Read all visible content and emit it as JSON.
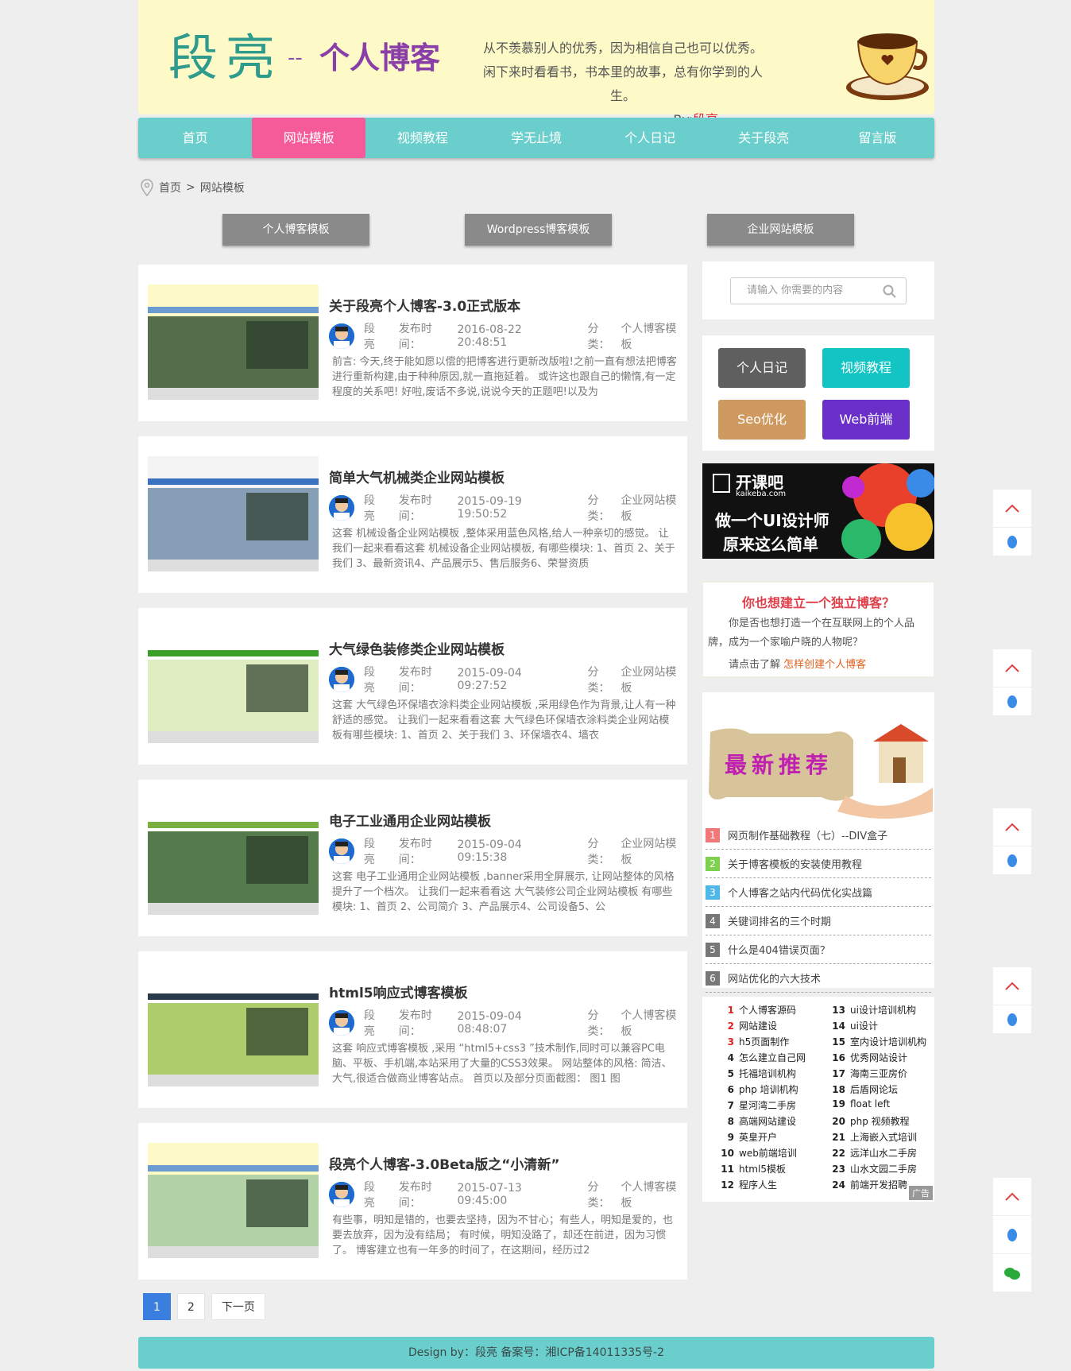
{
  "header": {
    "logo_main": "段亮",
    "logo_dash": "--",
    "logo_sub": "个人博客",
    "motto_line1": "从不羡慕别人的优秀，因为相信自己也可以优秀。",
    "motto_line2": "闲下来时看看书，书本里的故事，总有你学到的人生。",
    "by_prefix": "---By:",
    "by_name": "段亮"
  },
  "nav": {
    "items": [
      "首页",
      "网站模板",
      "视频教程",
      "学无止境",
      "个人日记",
      "关于段亮",
      "留言版"
    ],
    "active": "网站模板"
  },
  "breadcrumb": {
    "home": "首页",
    "sep": ">",
    "current": "网站模板"
  },
  "template_buttons": [
    "个人博客模板",
    "Wordpress博客模板",
    "企业网站模板"
  ],
  "articles": [
    {
      "title": "关于段亮个人博客-3.0正式版本",
      "author": "段亮",
      "time_label": "发布时间：",
      "time": "2016-08-22 20:48:51",
      "cat_label": "分类：",
      "category": "个人博客模板",
      "excerpt": "前言: 今天,终于能如愿以偿的把博客进行更新改版啦!之前一直有想法把博客进行重新构建,由于种种原因,就一直拖延着。 或许这也跟自己的懒惰,有一定程度的关系吧! 好啦,废话不多说,说说今天的正题吧!以及为"
    },
    {
      "title": "简单大气机械类企业网站模板",
      "author": "段亮",
      "time_label": "发布时间：",
      "time": "2015-09-19 19:50:52",
      "cat_label": "分类：",
      "category": "企业网站模板",
      "excerpt": "这套 机械设备企业网站模板 ,整体采用蓝色风格,给人一种亲切的感觉。 让我们一起来看看这套 机械设备企业网站模板, 有哪些模块: 1、首页 2、关于我们 3、最新资讯4、产品展示5、售后服务6、荣誉资质"
    },
    {
      "title": "大气绿色装修类企业网站模板",
      "author": "段亮",
      "time_label": "发布时间：",
      "time": "2015-09-04 09:27:52",
      "cat_label": "分类：",
      "category": "企业网站模板",
      "excerpt": "这套 大气绿色环保墙衣涂料类企业网站模板 ,采用绿色作为背景,让人有一种舒适的感觉。 让我们一起来看看这套 大气绿色环保墙衣涂料类企业网站模板有哪些模块: 1、首页 2、关于我们 3、环保墙衣4、墙衣"
    },
    {
      "title": "电子工业通用企业网站模板",
      "author": "段亮",
      "time_label": "发布时间：",
      "time": "2015-09-04 09:15:38",
      "cat_label": "分类：",
      "category": "企业网站模板",
      "excerpt": "这套 电子工业通用企业网站模板 ,banner采用全屏展示, 让网站整体的风格提升了一个档次。 让我们一起来看看这 大气装修公司企业网站模板 有哪些模块: 1、首页 2、公司简介 3、产品展示4、公司设备5、公"
    },
    {
      "title": "html5响应式博客模板",
      "author": "段亮",
      "time_label": "发布时间：",
      "time": "2015-09-04 08:48:07",
      "cat_label": "分类：",
      "category": "个人博客模板",
      "excerpt": "这套 响应式博客模板 ,采用 “html5+css3 ”技术制作,同时可以兼容PC电脑、平板、手机端,本站采用了大量的CSS3效果。 网站整体的风格: 简洁、大气,很适合做商业博客站点。 首页以及部分页面截图： 图1 图"
    },
    {
      "title": "段亮个人博客-3.0Beta版之“小清新”",
      "author": "段亮",
      "time_label": "发布时间：",
      "time": "2015-07-13 09:45:00",
      "cat_label": "分类：",
      "category": "个人博客模板",
      "excerpt": "有些事，明知是错的，也要去坚持，因为不甘心；有些人，明知是爱的，也要去放弃，因为没有结局； 有时候，明知没路了，却还在前进，因为习惯了。 博客建立也有一年多的时间了，在这期间，经历过2"
    }
  ],
  "pagination": {
    "pages": [
      "1",
      "2"
    ],
    "current": "1",
    "next": "下一页"
  },
  "sidebar": {
    "search_placeholder": "请输入 你需要的内容",
    "tags": [
      {
        "label": "个人日记",
        "color": "#5f5f5f"
      },
      {
        "label": "视频教程",
        "color": "#12c4c4"
      },
      {
        "label": "Seo优化",
        "color": "#cf9a60"
      },
      {
        "label": "Web前端",
        "color": "#6a2fc8"
      }
    ],
    "ad_brand": "开课吧",
    "ad_domain": "kaikeba.com",
    "ad_line1": "做一个UI设计师",
    "ad_line2": "原来这么简单",
    "cta_title": "你也想建立一个独立博客？",
    "cta_text": "你是否也想打造一个在互联网上的个人品牌，成为一个家喻户晓的人物呢？",
    "cta_prompt": "请点击了解",
    "cta_link": "怎样创建个人博客",
    "recent_banner": "最新推荐",
    "recent": [
      {
        "n": "1",
        "text": "网页制作基础教程（七）--DIV盒子",
        "color": "#f07878"
      },
      {
        "n": "2",
        "text": "关于博客模板的安装使用教程",
        "color": "#7ed04f"
      },
      {
        "n": "3",
        "text": "个人博客之站内代码优化实战篇",
        "color": "#4fb8e8"
      },
      {
        "n": "4",
        "text": "关键词排名的三个时期",
        "color": "#777777"
      },
      {
        "n": "5",
        "text": "什么是404错误页面？",
        "color": "#777777"
      },
      {
        "n": "6",
        "text": "网站优化的六大技术",
        "color": "#777777"
      }
    ],
    "hot_left": [
      {
        "n": "1",
        "t": "个人博客源码"
      },
      {
        "n": "2",
        "t": "网站建设"
      },
      {
        "n": "3",
        "t": "h5页面制作"
      },
      {
        "n": "4",
        "t": "怎么建立自己网"
      },
      {
        "n": "5",
        "t": "托福培训机构"
      },
      {
        "n": "6",
        "t": "php 培训机构"
      },
      {
        "n": "7",
        "t": "星河湾二手房"
      },
      {
        "n": "8",
        "t": "高端网站建设"
      },
      {
        "n": "9",
        "t": "英皇开户"
      },
      {
        "n": "10",
        "t": "web前端培训"
      },
      {
        "n": "11",
        "t": "html5模板"
      },
      {
        "n": "12",
        "t": "程序人生"
      }
    ],
    "hot_right": [
      {
        "n": "13",
        "t": "ui设计培训机构"
      },
      {
        "n": "14",
        "t": "ui设计"
      },
      {
        "n": "15",
        "t": "室内设计培训机构"
      },
      {
        "n": "16",
        "t": "优秀网站设计"
      },
      {
        "n": "17",
        "t": "海南三亚房价"
      },
      {
        "n": "18",
        "t": "后盾网论坛"
      },
      {
        "n": "19",
        "t": "float left"
      },
      {
        "n": "20",
        "t": "php 视频教程"
      },
      {
        "n": "21",
        "t": "上海嵌入式培训"
      },
      {
        "n": "22",
        "t": "远洋山水二手房"
      },
      {
        "n": "23",
        "t": "山水文园二手房"
      },
      {
        "n": "24",
        "t": "前端开发招聘"
      }
    ],
    "hot_ad_tag": "广告"
  },
  "footer": {
    "text": "Design by：段亮  备案号：湘ICP备14011335号-2"
  }
}
